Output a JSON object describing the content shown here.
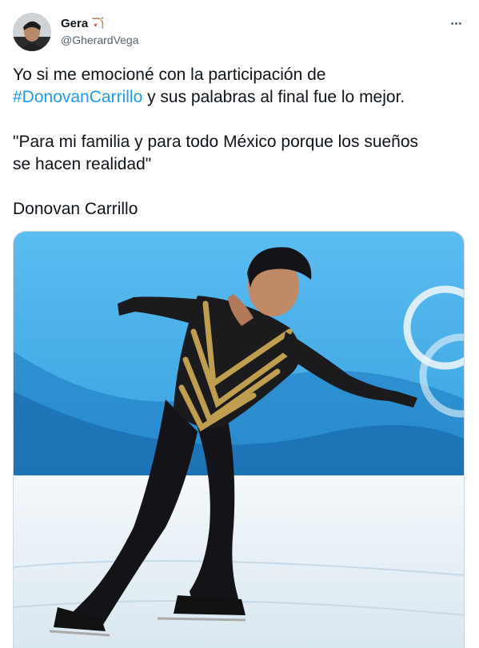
{
  "author": {
    "display_name": "Gera",
    "badge_emoji": "🏹",
    "handle": "@GherardVega",
    "avatar_icon": "profile-photo"
  },
  "more_label": "•••",
  "tweet": {
    "line1_prefix": "Yo si me emocioné con la participación de",
    "hashtag": "#DonovanCarrillo",
    "line2_suffix": " y sus palabras al final fue lo mejor.",
    "quote_line1": "\"Para mi familia y para todo México porque los sueños",
    "quote_line2": "se hacen realidad\"",
    "signature": "Donovan Carrillo"
  },
  "media": {
    "icon": "photo-figure-skater",
    "colors": {
      "sky": "#34a6e6",
      "ice": "#e7f1f7",
      "costume": "#1b1a1d",
      "gold": "#c9a653"
    }
  },
  "colors": {
    "link": "#1d9bf0",
    "secondary": "#536471",
    "text": "#0f1419"
  }
}
